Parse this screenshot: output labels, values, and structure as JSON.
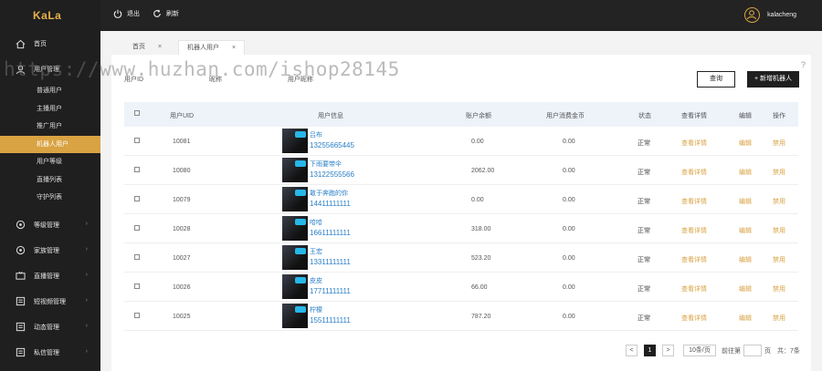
{
  "app": {
    "logo": "KaLa"
  },
  "sidebar": {
    "items": [
      {
        "label": "首页",
        "icon": "home-icon"
      },
      {
        "label": "用户管理",
        "icon": "user-icon"
      }
    ],
    "sub_items": [
      "普通用户",
      "主播用户",
      "推广用户",
      "机器人用户",
      "用户等级",
      "直播列表",
      "守护列表"
    ],
    "active_sub": "机器人用户",
    "groups": [
      {
        "label": "等级管理",
        "icon": "level-icon"
      },
      {
        "label": "家族管理",
        "icon": "family-icon"
      },
      {
        "label": "直播管理",
        "icon": "live-icon"
      },
      {
        "label": "短视频管理",
        "icon": "video-icon"
      },
      {
        "label": "动态管理",
        "icon": "dynamic-icon"
      },
      {
        "label": "私信管理",
        "icon": "message-icon"
      }
    ]
  },
  "topbar": {
    "logout": "退出",
    "refresh": "刷新",
    "username": "kalacheng"
  },
  "tabs": [
    {
      "label": "首页"
    },
    {
      "label": "机器人用户"
    }
  ],
  "filters": {
    "f1": "用户ID",
    "f2": "昵称",
    "f3": "用户昵称"
  },
  "buttons": {
    "query": "查询",
    "add": "+ 新增机器人"
  },
  "help": "?",
  "table": {
    "headers": [
      "用户UID",
      "用户信息",
      "账户余额",
      "用户消费金币",
      "状态",
      "查看详情",
      "编辑",
      "操作"
    ],
    "rows": [
      {
        "uid": "10081",
        "nick": "吕布",
        "phone": "13255665445",
        "balance": "0.00",
        "spent": "0.00",
        "status": "正常",
        "detail": "查看详情",
        "edit": "编辑",
        "op": "禁用"
      },
      {
        "uid": "10080",
        "nick": "下雨要带伞",
        "phone": "13122555566",
        "balance": "2062.00",
        "spent": "0.00",
        "status": "正常",
        "detail": "查看详情",
        "edit": "编辑",
        "op": "禁用"
      },
      {
        "uid": "10079",
        "nick": "敢于奔跑的你",
        "phone": "14411111111",
        "balance": "0.00",
        "spent": "0.00",
        "status": "正常",
        "detail": "查看详情",
        "edit": "编辑",
        "op": "禁用"
      },
      {
        "uid": "10028",
        "nick": "哈哈",
        "phone": "16611111111",
        "balance": "318.00",
        "spent": "0.00",
        "status": "正常",
        "detail": "查看详情",
        "edit": "编辑",
        "op": "禁用"
      },
      {
        "uid": "10027",
        "nick": "王宏",
        "phone": "13311111111",
        "balance": "523.20",
        "spent": "0.00",
        "status": "正常",
        "detail": "查看详情",
        "edit": "编辑",
        "op": "禁用"
      },
      {
        "uid": "10026",
        "nick": "皮皮",
        "phone": "17711111111",
        "balance": "66.00",
        "spent": "0.00",
        "status": "正常",
        "detail": "查看详情",
        "edit": "编辑",
        "op": "禁用"
      },
      {
        "uid": "10025",
        "nick": "柠檬",
        "phone": "15511111111",
        "balance": "787.20",
        "spent": "0.00",
        "status": "正常",
        "detail": "查看详情",
        "edit": "编辑",
        "op": "禁用"
      }
    ]
  },
  "pagination": {
    "prev": "<",
    "current": "1",
    "next": ">",
    "per_page": "10条/页",
    "goto": "前往第",
    "page_unit": "页",
    "total": "共：7条"
  },
  "watermark": "https://www.huzhan.com/ishop28145",
  "colors": {
    "accent": "#d9a242",
    "dark": "#1f1f1f",
    "link": "#2a7fc7"
  }
}
